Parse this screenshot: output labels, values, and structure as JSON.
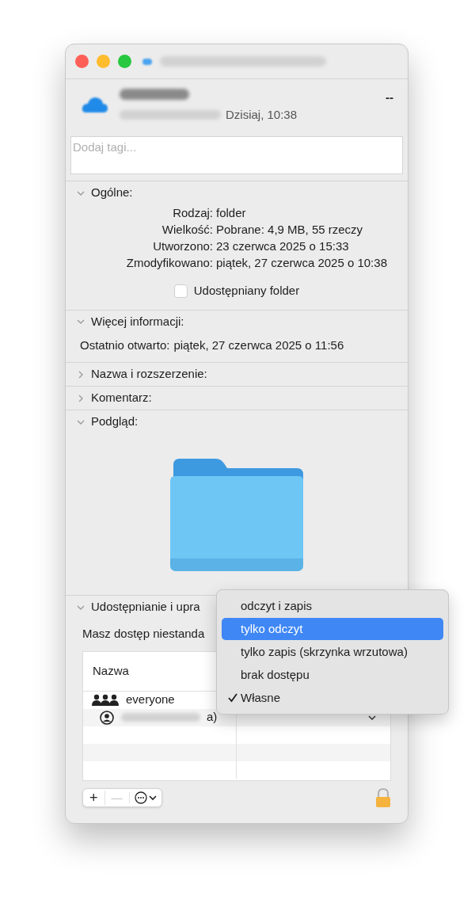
{
  "header": {
    "modified_value": "Dzisiaj, 10:38",
    "size": "--"
  },
  "tags": {
    "placeholder": "Dodaj tagi..."
  },
  "sections": [
    {
      "kind": "general",
      "title": "Ogólne:",
      "expanded": true,
      "rows": [
        {
          "label": "Rodzaj:",
          "value": "folder"
        },
        {
          "label": "Wielkość:",
          "value": "Pobrane: 4,9 MB, 55 rzeczy"
        },
        {
          "label": "Utworzono:",
          "value": "23 czerwca 2025 o 15:33"
        },
        {
          "label": "Zmodyfikowano:",
          "value": "piątek, 27 czerwca 2025 o 10:38"
        }
      ],
      "checkbox": {
        "label": "Udostępniany folder",
        "checked": false
      }
    },
    {
      "kind": "info",
      "title": "Więcej informacji:",
      "expanded": true,
      "rows": [
        {
          "label": "Ostatnio otwarto:",
          "value": "piątek, 27 czerwca 2025 o 11:56"
        }
      ]
    },
    {
      "title": "Nazwa i rozszerzenie:",
      "expanded": false
    },
    {
      "title": "Komentarz:",
      "expanded": false
    },
    {
      "kind": "preview",
      "title": "Podgląd:",
      "expanded": true
    },
    {
      "kind": "sharing",
      "title": "Udostępnianie i upra",
      "expanded": true,
      "note": "Masz dostęp niestanda",
      "table": {
        "columns": [
          "Nazwa"
        ],
        "rows": [
          {
            "kind": "group",
            "name": "everyone",
            "suffix": ""
          },
          {
            "kind": "user",
            "name": "",
            "suffix": "a)"
          }
        ]
      }
    }
  ],
  "toolbar": {
    "add": "+",
    "remove": "—"
  },
  "menu": {
    "items": [
      {
        "label": "odczyt i zapis",
        "selected": false,
        "checked": false
      },
      {
        "label": "tylko odczyt",
        "selected": true,
        "checked": false
      },
      {
        "label": "tylko zapis (skrzynka wrzutowa)",
        "selected": false,
        "checked": false
      },
      {
        "label": "brak dostępu",
        "selected": false,
        "checked": false
      },
      {
        "label": "Własne",
        "selected": false,
        "checked": true
      }
    ]
  }
}
